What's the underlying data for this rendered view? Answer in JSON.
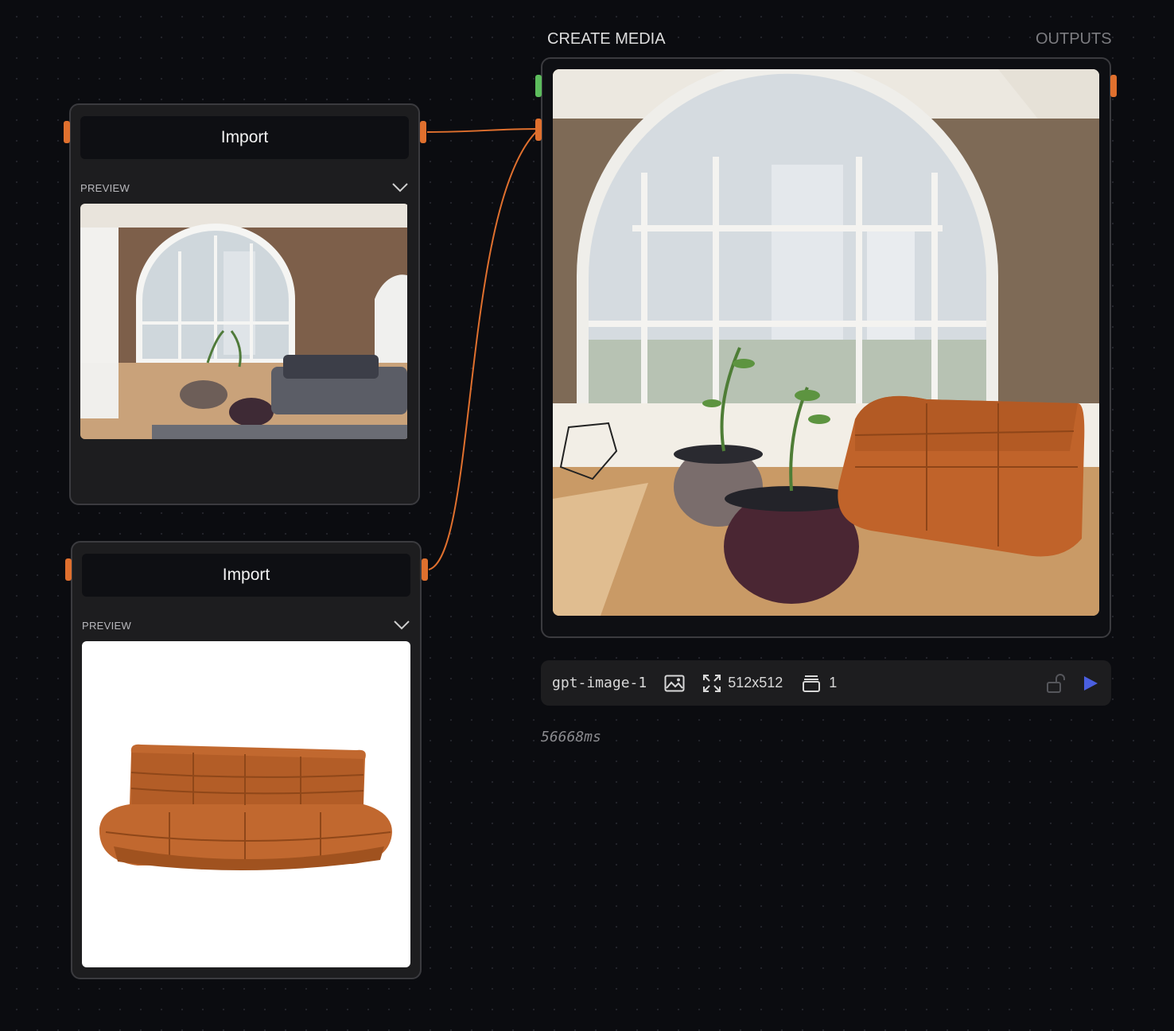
{
  "import_nodes": [
    {
      "title": "Import",
      "preview_label": "PREVIEW",
      "image": "living-room-interior-photo"
    },
    {
      "title": "Import",
      "preview_label": "PREVIEW",
      "image": "orange-leather-sofa-photo"
    }
  ],
  "create_media": {
    "title": "CREATE MEDIA",
    "outputs_label": "OUTPUTS",
    "output_image": "living-room-with-orange-sofa-render"
  },
  "toolbar": {
    "model": "gpt-image-1",
    "size": "512x512",
    "count": "1"
  },
  "elapsed": "56668ms",
  "colors": {
    "background": "#0b0c10",
    "node": "#1d1d1f",
    "port_orange": "#e0702e",
    "port_green": "#5dbd5d",
    "run_blue": "#4a5fe0"
  }
}
